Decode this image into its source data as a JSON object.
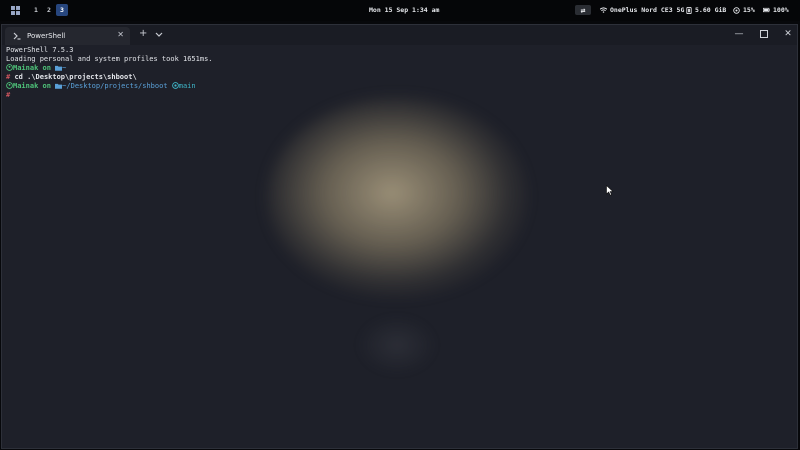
{
  "statusbar": {
    "workspaces": [
      "1",
      "2",
      "3"
    ],
    "active_workspace": "3",
    "clock": "Mon 15 Sep 1:34 am",
    "wifi": "OnePlus Nord CE3 5G",
    "memory": "5.60 GiB",
    "cpu": "15%",
    "battery": "100%"
  },
  "window": {
    "tab_title": "PowerShell",
    "new_tab": "+"
  },
  "terminal": {
    "line1": "PowerShell 7.5.3",
    "line2": "Loading personal and system profiles took 1651ms.",
    "user": "Mainak",
    "on": "on",
    "home_dir": "~",
    "prompt_char": "#",
    "command": "cd .\\Desktop\\projects\\shboot\\",
    "cwd": "~/Desktop/projects/shboot",
    "branch": "main"
  },
  "colors": {
    "accent": "#27467e",
    "green": "#4ec279",
    "blue": "#5aa0d8",
    "red": "#ec5f67"
  }
}
